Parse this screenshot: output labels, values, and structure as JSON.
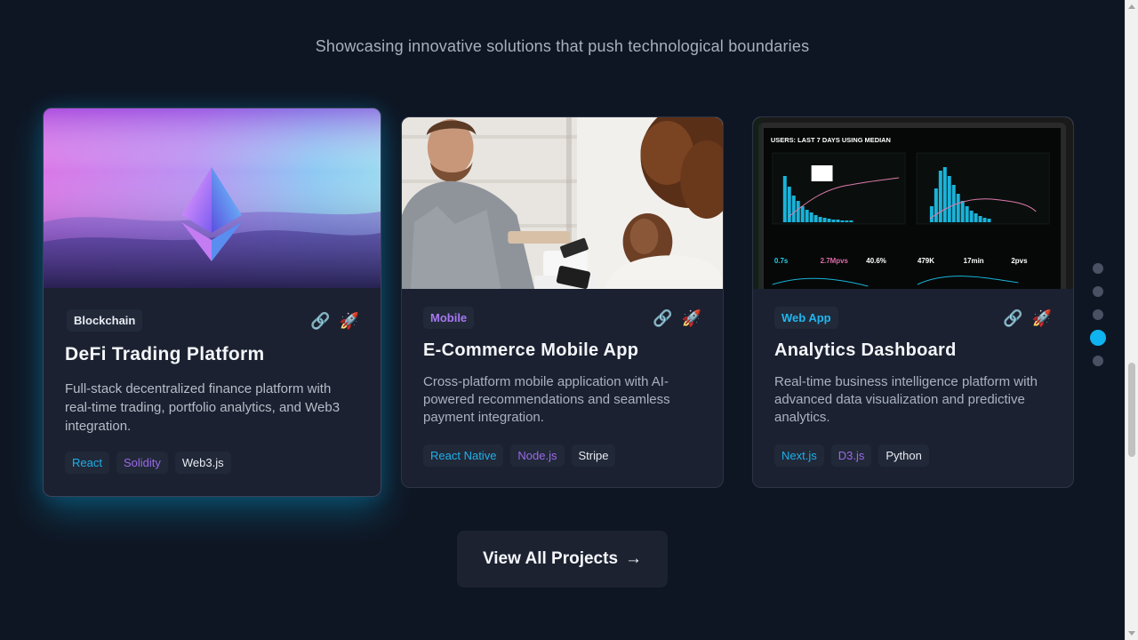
{
  "section": {
    "subtitle": "Showcasing innovative solutions that push technological boundaries"
  },
  "projects": [
    {
      "category": "Blockchain",
      "title": "DeFi Trading Platform",
      "description": "Full-stack decentralized finance platform with real-time trading, portfolio analytics, and Web3 integration.",
      "tags": [
        "React",
        "Solidity",
        "Web3.js"
      ],
      "actions": [
        "🔗",
        "🚀"
      ]
    },
    {
      "category": "Mobile",
      "title": "E-Commerce Mobile App",
      "description": "Cross-platform mobile application with AI-powered recommendations and seamless payment integration.",
      "tags": [
        "React Native",
        "Node.js",
        "Stripe"
      ],
      "actions": [
        "🔗",
        "🚀"
      ]
    },
    {
      "category": "Web App",
      "title": "Analytics Dashboard",
      "description": "Real-time business intelligence platform with advanced data visualization and predictive analytics.",
      "tags": [
        "Next.js",
        "D3.js",
        "Python"
      ],
      "actions": [
        "🔗",
        "🚀"
      ],
      "screen": {
        "header": "USERS: LAST 7 DAYS USING MEDIAN",
        "metrics": [
          "0.7s",
          "2.7Mpvs",
          "40.6%",
          "479K",
          "17min",
          "2pvs"
        ]
      }
    }
  ],
  "cta": {
    "label": "View All Projects",
    "arrow": "→"
  },
  "pagination": {
    "count": 5,
    "active_index": 3
  },
  "colors": {
    "accent_cyan": "#0fb3f0",
    "accent_purple": "#9b6ae8",
    "background": "#0f1623",
    "card": "#1b2130"
  }
}
